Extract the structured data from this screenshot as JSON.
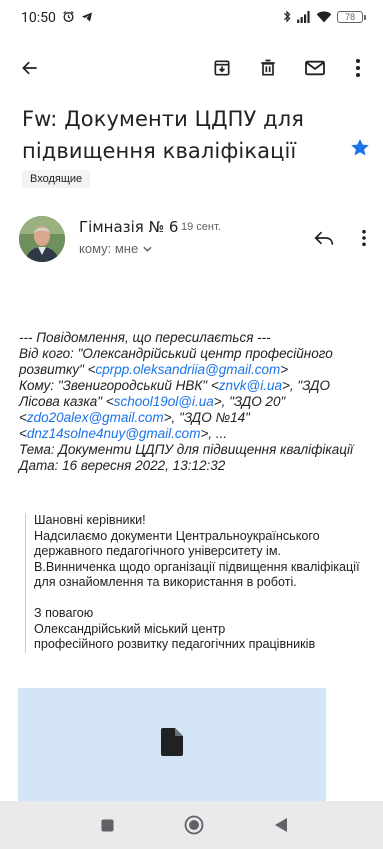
{
  "status_bar": {
    "time": "10:50",
    "battery": "78"
  },
  "icons": {
    "back": "arrow-left-icon",
    "archive": "archive-icon",
    "delete": "trash-icon",
    "mark_unread": "mail-icon",
    "more": "more-vert-icon",
    "star": "star-icon",
    "reply": "reply-icon",
    "chevron": "chevron-down-icon",
    "file": "file-icon"
  },
  "colors": {
    "accent": "#1a73e8",
    "star": "#1a73e8",
    "attachment_bg": "#d4e4f7",
    "nav_bg": "#eaeaea"
  },
  "email": {
    "subject": "Fw: Документи ЦДПУ для підвищення кваліфікації",
    "label": "Входящие",
    "sender": "Гімназія № 6",
    "date": "19 сент.",
    "recipient": "кому: мне"
  },
  "forwarded": {
    "header": "--- Повідомлення, що пересилається ---",
    "from_label": "Від кого: ",
    "from_name": "\"Олександрійський центр професійного розвитку\" <",
    "from_email": "cprpp.oleksandriia@gmail.com",
    "from_close": ">",
    "to_label": "Кому: ",
    "to_1_name": "\"Звенигородський НВК\" <",
    "to_1_email": "znvk@i.ua",
    "to_2_name": ">, \"ЗДО Лісова казка\" <",
    "to_2_email": "school19ol@i.ua",
    "to_3_name": ">, \"ЗДО 20\" <",
    "to_3_email": "zdo20alex@gmail.com",
    "to_4_name": ">, \"ЗДО №14\" <",
    "to_4_email": "dnz14solne4nuy@gmail.com",
    "to_end": ">, ...",
    "subject_line": "Тема: Документи ЦДПУ для підвищення кваліфікації",
    "date_line": "Дата: 16 вересня 2022, 13:12:32"
  },
  "body": {
    "greeting": "Шановні керівники!",
    "text": "Надсилаємо документи Центральноукраїнського державного педагогічного університету ім. В.Винниченка щодо організації підвищення кваліфікації для ознайомлення та використання в роботі.",
    "signoff": "З повагою",
    "sig_line1": "Олександрійський міський центр",
    "sig_line2": "професійного розвитку педагогічних працівників"
  }
}
